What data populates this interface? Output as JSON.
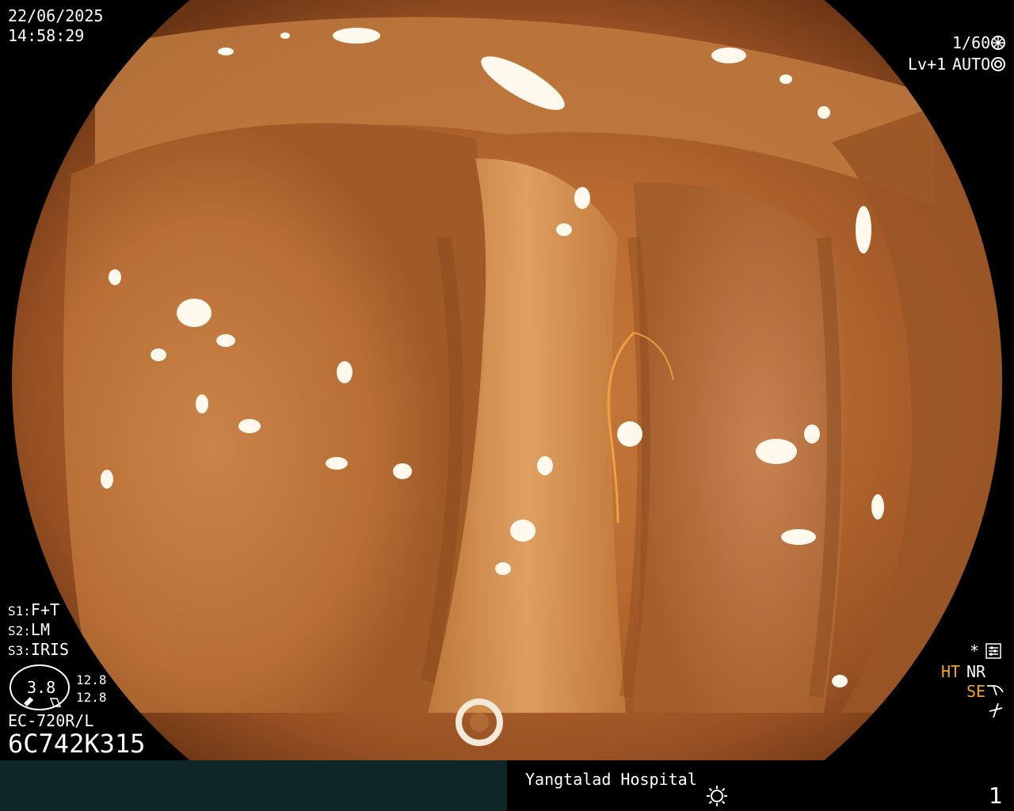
{
  "overlay": {
    "date": "22/06/2025",
    "time": "14:58:29",
    "shutter": "1/60",
    "level": "Lv+1",
    "auto_label": "AUTO",
    "s1_label": "S1:",
    "s1_value": "F+T",
    "s2_label": "S2:",
    "s2_value": "LM",
    "s3_label": "S3:",
    "s3_value": "IRIS",
    "dial_value": "3.8",
    "zoom_top": "12.8",
    "zoom_bottom": "12.8",
    "scope_model": "EC-720R/L",
    "serial": "6C742K315",
    "star": "*",
    "ht": "HT",
    "nr": "NR",
    "se": "SE"
  },
  "footer": {
    "hospital": "Yangtalad Hospital",
    "page_number": "1"
  },
  "colors": {
    "accent_orange": "#f2a51c",
    "bar_left": "#0f2628"
  },
  "icons": [
    "aperture-icon",
    "iris-icon",
    "settings-icon",
    "curve-icon",
    "nonlinear-icon",
    "brightness-icon"
  ]
}
